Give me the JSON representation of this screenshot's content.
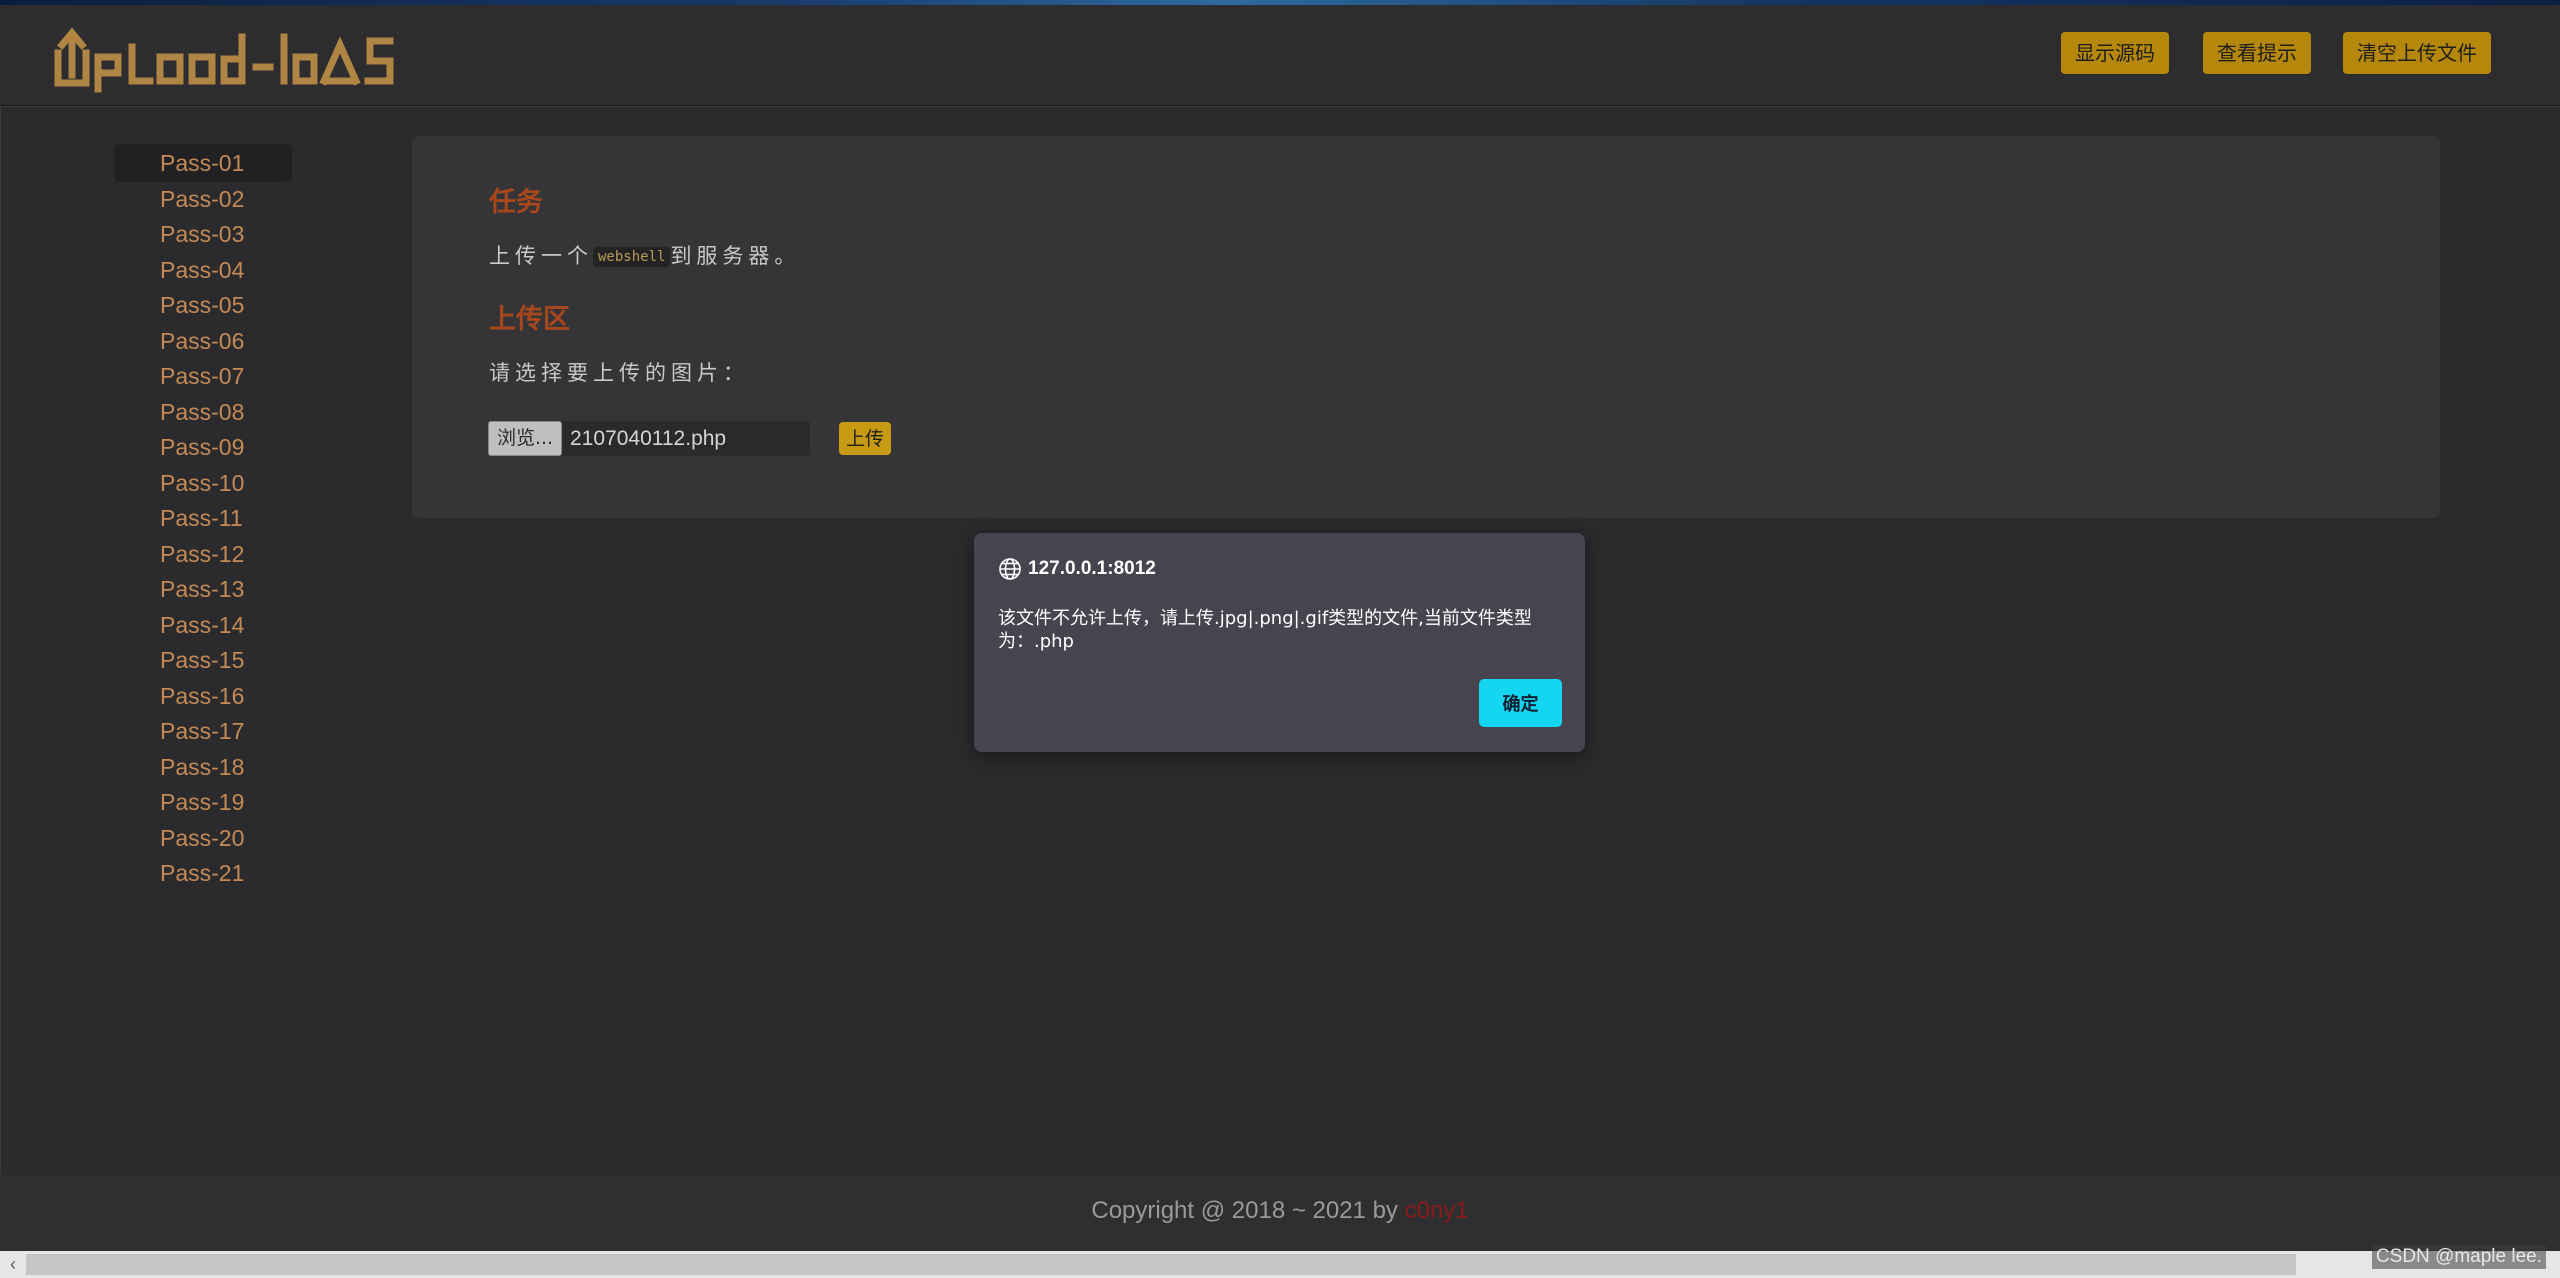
{
  "header": {
    "logo_text": "Upload-labs",
    "buttons": {
      "show_source": "显示源码",
      "view_hint": "查看提示",
      "clear_uploads": "清空上传文件"
    },
    "colors": {
      "button_bg": "#b5870a",
      "logo": "#b08543"
    }
  },
  "sidebar": {
    "items": [
      {
        "label": "Pass-01"
      },
      {
        "label": "Pass-02"
      },
      {
        "label": "Pass-03"
      },
      {
        "label": "Pass-04"
      },
      {
        "label": "Pass-05"
      },
      {
        "label": "Pass-06"
      },
      {
        "label": "Pass-07"
      },
      {
        "label": "Pass-08"
      },
      {
        "label": "Pass-09"
      },
      {
        "label": "Pass-10"
      },
      {
        "label": "Pass-11"
      },
      {
        "label": "Pass-12"
      },
      {
        "label": "Pass-13"
      },
      {
        "label": "Pass-14"
      },
      {
        "label": "Pass-15"
      },
      {
        "label": "Pass-16"
      },
      {
        "label": "Pass-17"
      },
      {
        "label": "Pass-18"
      },
      {
        "label": "Pass-19"
      },
      {
        "label": "Pass-20"
      },
      {
        "label": "Pass-21"
      }
    ],
    "active": "Pass-01"
  },
  "main": {
    "task_heading": "任务",
    "task_text_before": "上传一个",
    "task_code": "webshell",
    "task_text_after": "到服务器。",
    "upload_heading": "上传区",
    "upload_prompt": "请选择要上传的图片：",
    "browse_label": "浏览...",
    "file_name": "2107040112.php",
    "upload_button": "上传"
  },
  "dialog": {
    "title": "127.0.0.1:8012",
    "message": "该文件不允许上传，请上传.jpg|.png|.gif类型的文件,当前文件类型为：.php",
    "ok_label": "确定",
    "icon": "globe-icon"
  },
  "footer": {
    "copyright": "Copyright @ 2018 ~ 2021 by",
    "author": "c0ny1"
  },
  "watermark": "CSDN @maple lee."
}
